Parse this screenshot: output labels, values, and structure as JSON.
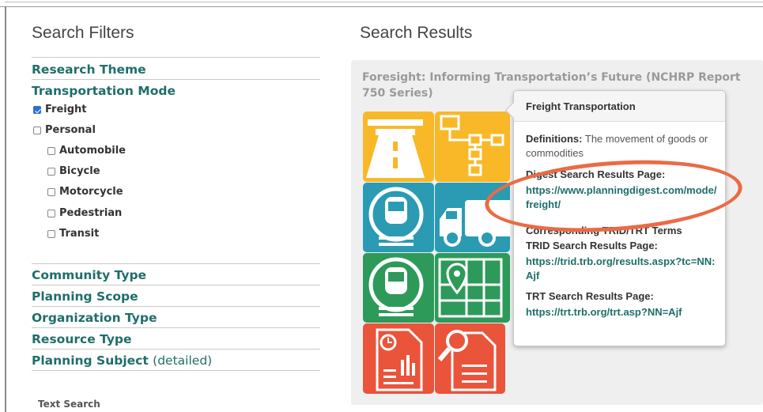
{
  "filters": {
    "title": "Search Filters",
    "sections": {
      "research_theme": "Research Theme",
      "transportation_mode": "Transportation Mode",
      "community_type": "Community Type",
      "planning_scope": "Planning Scope",
      "organization_type": "Organization Type",
      "resource_type": "Resource Type",
      "planning_subject": "Planning Subject",
      "planning_subject_detail": "(detailed)"
    },
    "modes": {
      "freight": "Freight",
      "personal": "Personal",
      "automobile": "Automobile",
      "bicycle": "Bicycle",
      "motorcycle": "Motorcycle",
      "pedestrian": "Pedestrian",
      "transit": "Transit"
    },
    "text_search_label": "Text Search"
  },
  "results": {
    "title": "Search Results",
    "item_title": "Foresight: Informing Transportation’s Future (NCHRP Report 750 Series)"
  },
  "tooltip": {
    "title": "Freight Transportation",
    "definitions_label": "Definitions:",
    "definitions_text": "The movement of goods or commodities",
    "digest_label": "Digest Search Results Page:",
    "digest_url": "https://www.planningdigest.com/mode/freight/",
    "trid_trt_label": "Corresponding TRID/TRT Terms",
    "trid_label": "TRID Search Results Page:",
    "trid_url": "https://trid.trb.org/results.aspx?tc=NN:Ajf",
    "trt_label": "TRT Search Results Page:",
    "trt_url": "https://trt.trb.org/trt.asp?NN=Ajf"
  },
  "colors": {
    "accent_teal": "#1f6e6a",
    "tile_yellow": "#f8b828",
    "tile_blue": "#2a9bb3",
    "tile_green": "#2d9a5a",
    "tile_orange": "#e9543a",
    "highlight_ellipse": "#ea6b45"
  }
}
